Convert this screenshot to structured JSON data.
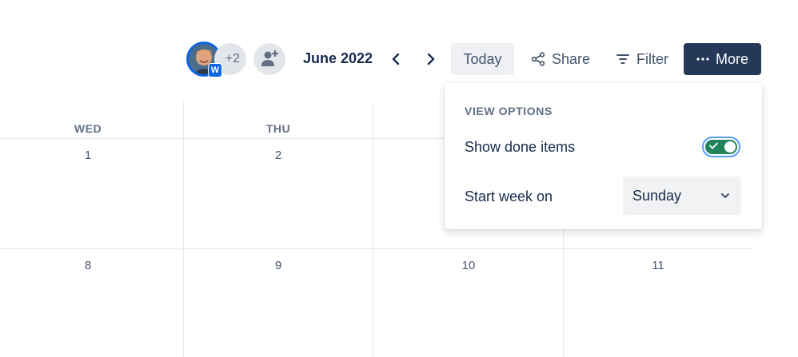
{
  "toolbar": {
    "avatar_badge": "W",
    "more_avatars": "+2",
    "month": "June 2022",
    "today_label": "Today",
    "share_label": "Share",
    "filter_label": "Filter",
    "more_label": "More"
  },
  "icons": {
    "add_people": "person-plus-icon",
    "prev": "chevron-left-icon",
    "next": "chevron-right-icon",
    "share": "share-icon",
    "filter": "filter-icon",
    "more": "ellipsis-icon",
    "check": "check-icon",
    "dropdown": "chevron-down-icon"
  },
  "calendar": {
    "day_headers": [
      "WED",
      "THU"
    ],
    "week1": [
      "1",
      "2"
    ],
    "week2": [
      "8",
      "9",
      "10",
      "11"
    ]
  },
  "view_options": {
    "heading": "VIEW OPTIONS",
    "show_done_label": "Show done items",
    "show_done_value": true,
    "start_week_label": "Start week on",
    "start_week_value": "Sunday"
  },
  "colors": {
    "primary_button": "#253858",
    "toggle_on": "#1f845a",
    "focus_ring": "#579dff",
    "badge": "#0c66e4"
  }
}
